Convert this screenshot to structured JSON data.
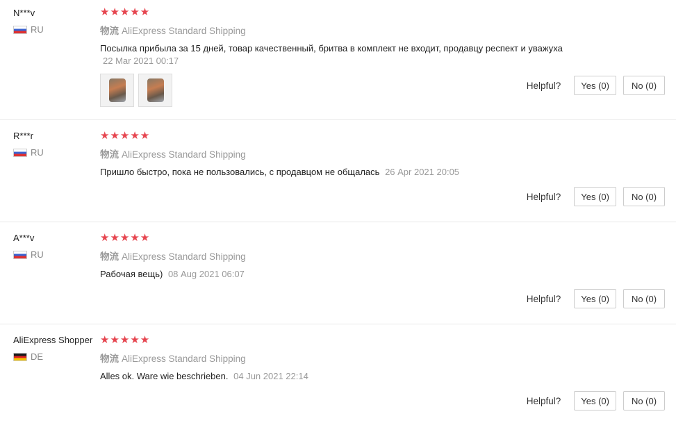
{
  "helpful_label": "Helpful?",
  "stars": "★★★★★",
  "colors": {
    "star": "#e6454f",
    "muted": "#999999"
  },
  "reviews": [
    {
      "user": "N***v",
      "country": "RU",
      "rating": 5,
      "shipping_label": "物流",
      "shipping": "AliExpress Standard Shipping",
      "text": "Посылка прибыла за 15 дней, товар качественный, бритва в комплект не входит, продавцу респект и уважуха",
      "date": "22 Mar 2021 00:17",
      "yes": "Yes (0)",
      "no": "No (0)"
    },
    {
      "user": "R***r",
      "country": "RU",
      "rating": 5,
      "shipping_label": "物流",
      "shipping": "AliExpress Standard Shipping",
      "text": "Пришло быстро, пока не пользовались, с продавцом не общалась",
      "date": "26 Apr 2021 20:05",
      "yes": "Yes (0)",
      "no": "No (0)"
    },
    {
      "user": "A***v",
      "country": "RU",
      "rating": 5,
      "shipping_label": "物流",
      "shipping": "AliExpress Standard Shipping",
      "text": "Рабочая вещь)",
      "date": "08 Aug 2021 06:07",
      "yes": "Yes (0)",
      "no": "No (0)"
    },
    {
      "user": "AliExpress Shopper",
      "country": "DE",
      "rating": 5,
      "shipping_label": "物流",
      "shipping": "AliExpress Standard Shipping",
      "text": "Alles ok. Ware wie beschrieben.",
      "date": "04 Jun 2021 22:14",
      "yes": "Yes (0)",
      "no": "No (0)"
    }
  ]
}
